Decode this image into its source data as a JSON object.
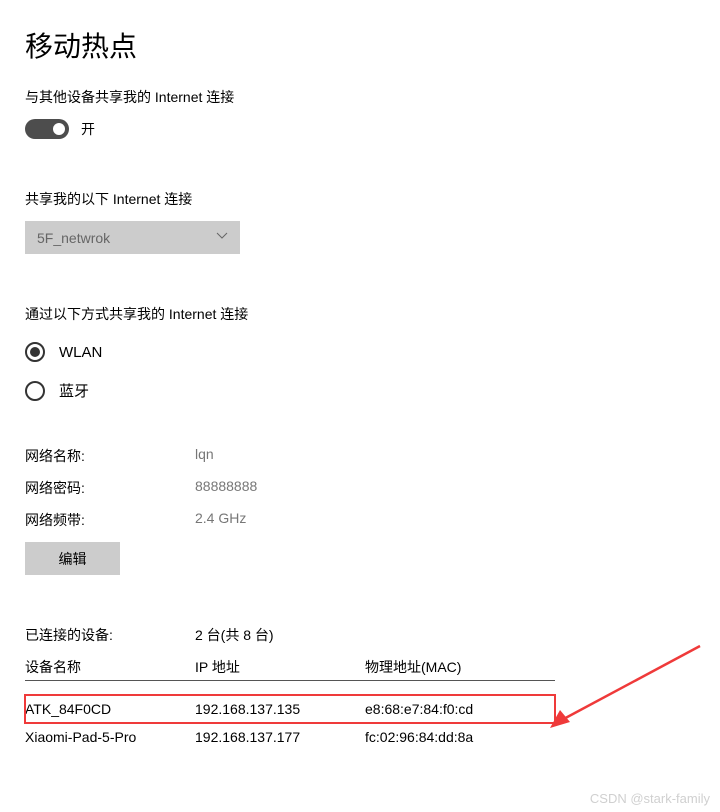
{
  "title": "移动热点",
  "share_label": "与其他设备共享我的 Internet 连接",
  "toggle_state": "开",
  "share_from_label": "共享我的以下 Internet 连接",
  "dropdown_value": "5F_netwrok",
  "share_via_label": "通过以下方式共享我的 Internet 连接",
  "radio": {
    "wlan": "WLAN",
    "bluetooth": "蓝牙"
  },
  "info": {
    "name_label": "网络名称:",
    "name_value": "lqn",
    "pwd_label": "网络密码:",
    "pwd_value": "88888888",
    "band_label": "网络频带:",
    "band_value": "2.4 GHz"
  },
  "edit_label": "编辑",
  "devices": {
    "connected_label": "已连接的设备:",
    "connected_value": "2 台(共 8 台)",
    "col_name": "设备名称",
    "col_ip": "IP 地址",
    "col_mac": "物理地址(MAC)",
    "rows": [
      {
        "name": "ATK_84F0CD",
        "ip": "192.168.137.135",
        "mac": "e8:68:e7:84:f0:cd"
      },
      {
        "name": "Xiaomi-Pad-5-Pro",
        "ip": "192.168.137.177",
        "mac": "fc:02:96:84:dd:8a"
      }
    ]
  },
  "watermark": "CSDN @stark-family"
}
